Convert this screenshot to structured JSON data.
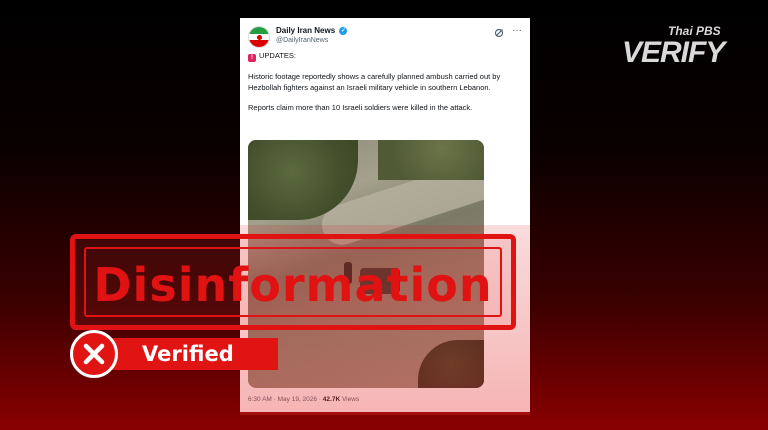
{
  "tweet": {
    "author_name": "Daily Iran News",
    "author_handle": "@DailyIranNews",
    "updates_label": "UPDATES:",
    "paragraph1": "Historic footage reportedly shows a carefully planned ambush carried out by Hezbollah fighters against an Israeli military vehicle in southern Lebanon.",
    "paragraph2": "Reports claim more than 10 Israeli soldiers were killed in the attack.",
    "time": "6:30 AM · May 19, 2026 ·",
    "views_count": "42.7K",
    "views_label": "Views",
    "icons": [
      "verified-badge-icon",
      "grok-icon",
      "more-icon",
      "alert-icon"
    ]
  },
  "stamp": {
    "label": "Disinformation",
    "color": "#e01212"
  },
  "verdict": {
    "label": "Verified",
    "icon": "x-icon",
    "color": "#e11414"
  },
  "logo": {
    "small": "Thai PBS",
    "big": "VERIFY"
  }
}
